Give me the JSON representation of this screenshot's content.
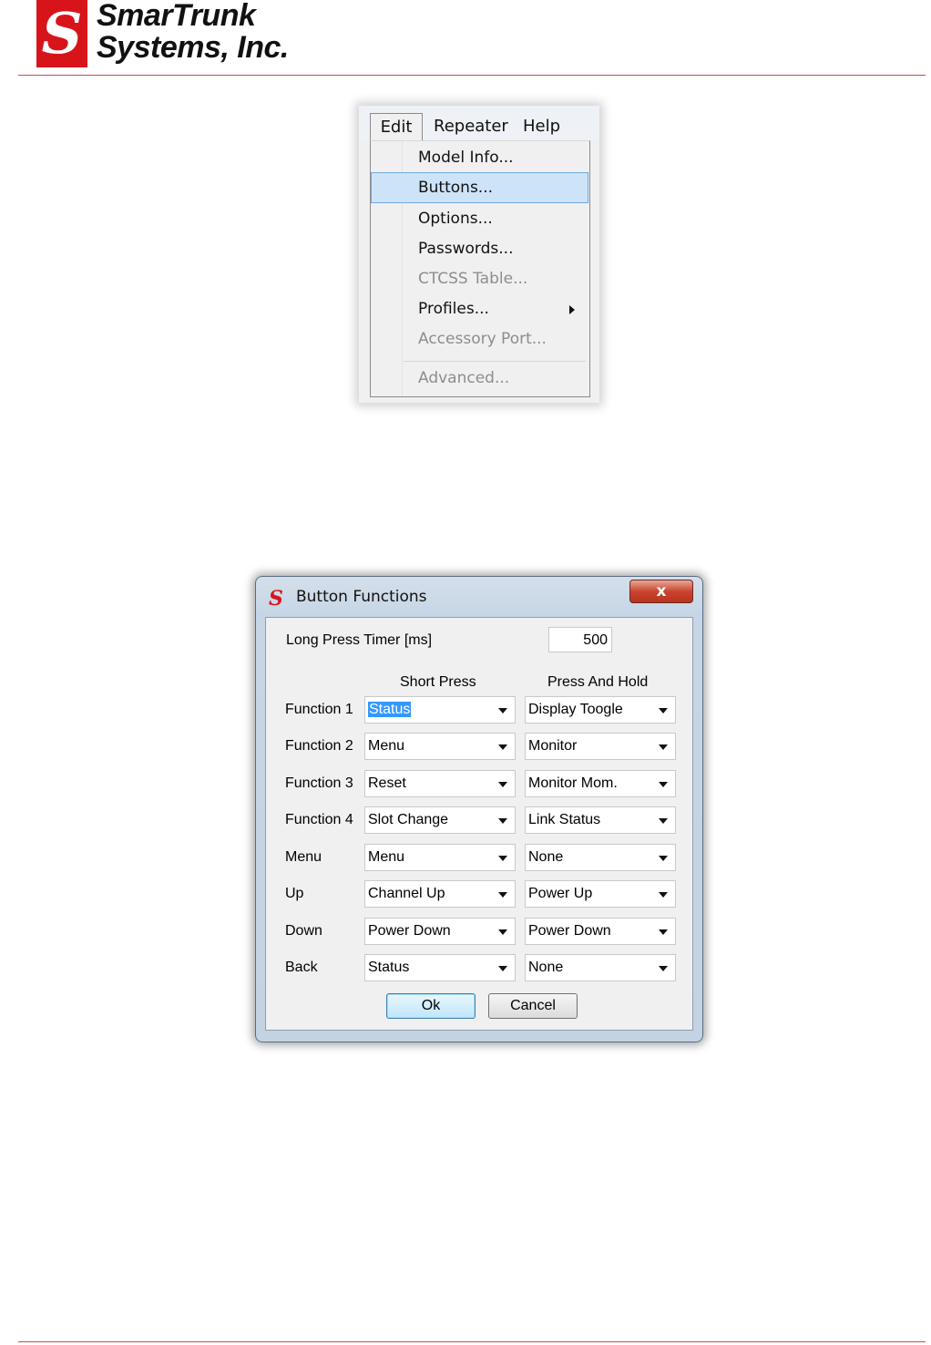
{
  "brand": {
    "logo_glyph": "S",
    "name_line1": "SmarTrunk",
    "name_line2": "Systems, Inc.",
    "accent_color": "#d8141b",
    "rule_color": "#c0504d"
  },
  "menu": {
    "bar": [
      {
        "label": "Edit",
        "open": true
      },
      {
        "label": "Repeater"
      },
      {
        "label": "Help"
      }
    ],
    "items": [
      {
        "label": "Model Info...",
        "enabled": true
      },
      {
        "label": "Buttons...",
        "enabled": true,
        "highlighted": true
      },
      {
        "label": "Options...",
        "enabled": true
      },
      {
        "label": "Passwords...",
        "enabled": true
      },
      {
        "label": "CTCSS Table...",
        "enabled": false
      },
      {
        "label": "Profiles...",
        "enabled": true,
        "submenu": true,
        "icon": "submenu-arrow-icon"
      },
      {
        "label": "Accessory Port...",
        "enabled": false
      },
      {
        "label": "Advanced...",
        "enabled": false
      }
    ]
  },
  "dialog": {
    "title": "Button Functions",
    "app_icon": "S",
    "close_label": "x",
    "long_press_label": "Long Press Timer [ms]",
    "long_press_value": "500",
    "col_short": "Short Press",
    "col_hold": "Press And Hold",
    "rows": [
      {
        "label": "Function 1",
        "short": "Status",
        "hold": "Display Toogle"
      },
      {
        "label": "Function 2",
        "short": "Menu",
        "hold": "Monitor"
      },
      {
        "label": "Function 3",
        "short": "Reset",
        "hold": "Monitor Mom."
      },
      {
        "label": "Function 4",
        "short": "Slot Change",
        "hold": "Link Status"
      },
      {
        "label": "Menu",
        "short": "Menu",
        "hold": "None"
      },
      {
        "label": "Up",
        "short": "Channel Up",
        "hold": "Power Up"
      },
      {
        "label": "Down",
        "short": "Power Down",
        "hold": "Power Down"
      },
      {
        "label": "Back",
        "short": "Status",
        "hold": "None"
      }
    ],
    "ok_label": "Ok",
    "cancel_label": "Cancel"
  }
}
